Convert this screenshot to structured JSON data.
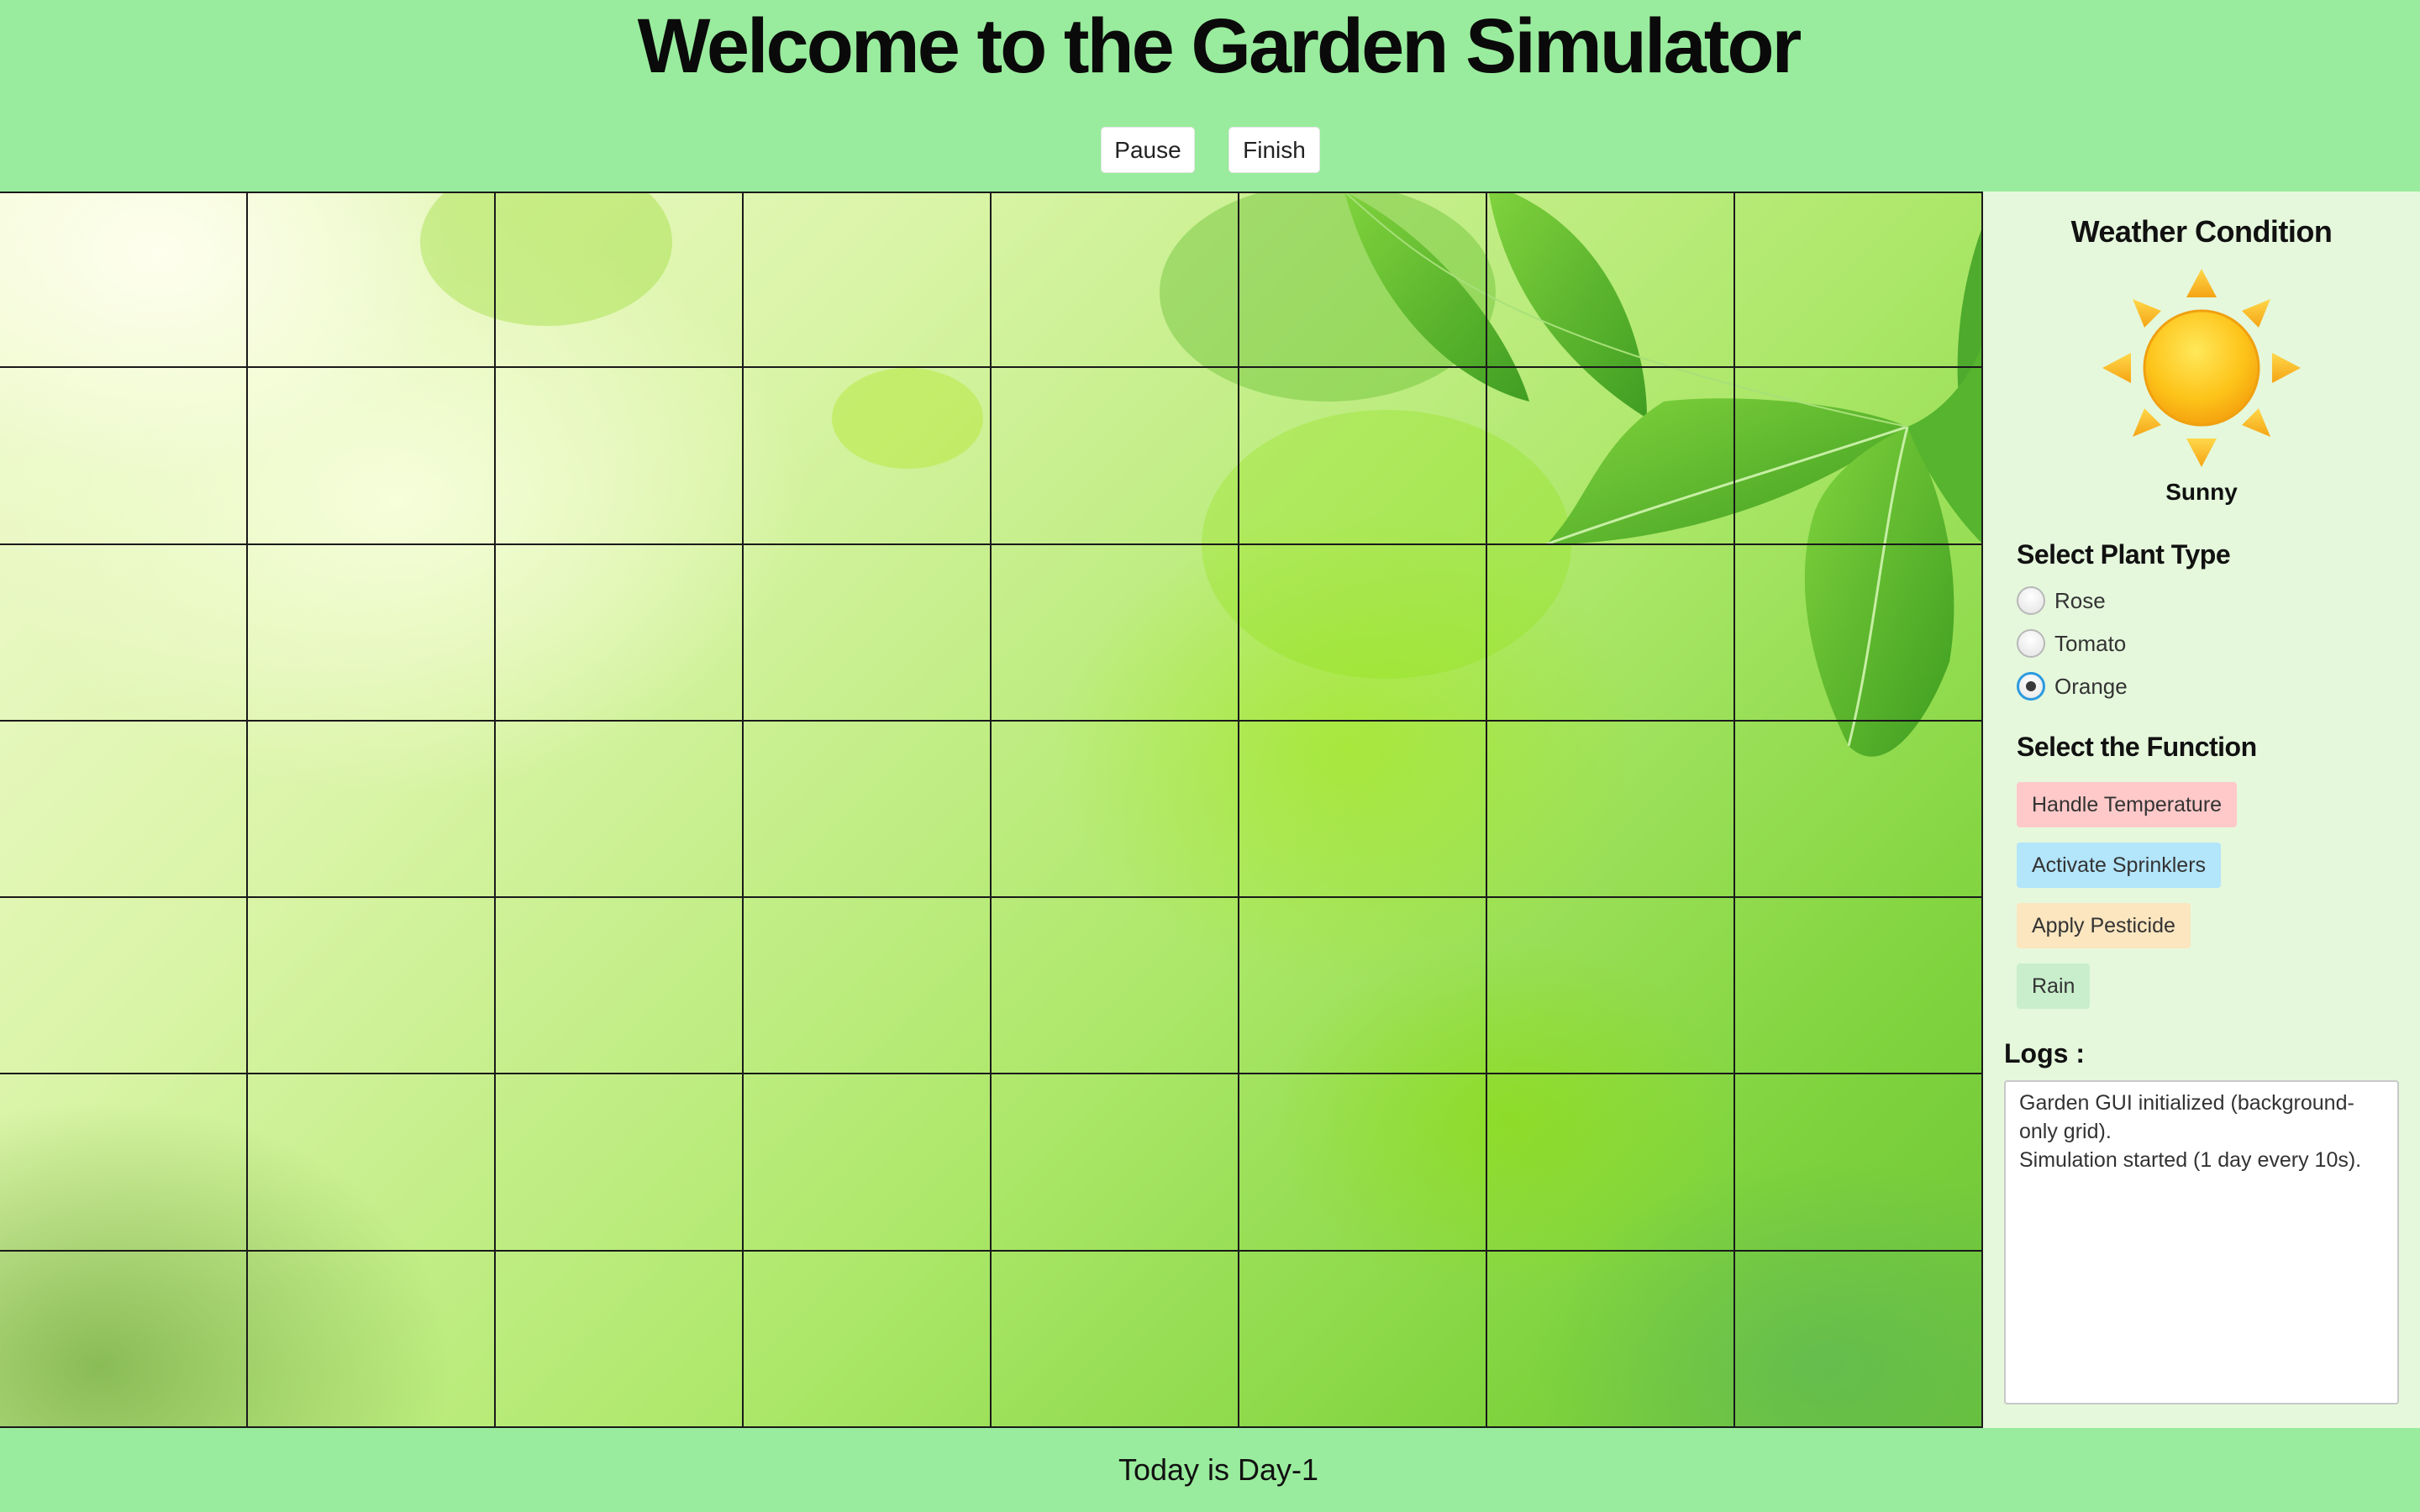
{
  "header": {
    "title": "Welcome to the Garden Simulator",
    "pause_label": "Pause",
    "finish_label": "Finish",
    "background_color": "#99ec9d"
  },
  "garden": {
    "rows": 7,
    "columns": 8,
    "background": "green leaves image"
  },
  "weather": {
    "title": "Weather Condition",
    "condition": "Sunny",
    "icon": "sun-icon"
  },
  "plant_type": {
    "title": "Select Plant Type",
    "options": [
      {
        "label": "Rose",
        "selected": false
      },
      {
        "label": "Tomato",
        "selected": false
      },
      {
        "label": "Orange",
        "selected": true
      }
    ]
  },
  "functions": {
    "title": "Select the Function",
    "buttons": [
      {
        "label": "Handle Temperature",
        "color": "#ffc9c9"
      },
      {
        "label": "Activate Sprinklers",
        "color": "#b3e5fb"
      },
      {
        "label": "Apply Pesticide",
        "color": "#fbe6bf"
      },
      {
        "label": "Rain",
        "color": "#c9eecb"
      }
    ]
  },
  "logs": {
    "title": "Logs :",
    "lines": [
      "Garden GUI initialized (background-only grid).",
      "Simulation started (1 day every 10s)."
    ]
  },
  "footer": {
    "day_text": "Today is Day-1"
  }
}
